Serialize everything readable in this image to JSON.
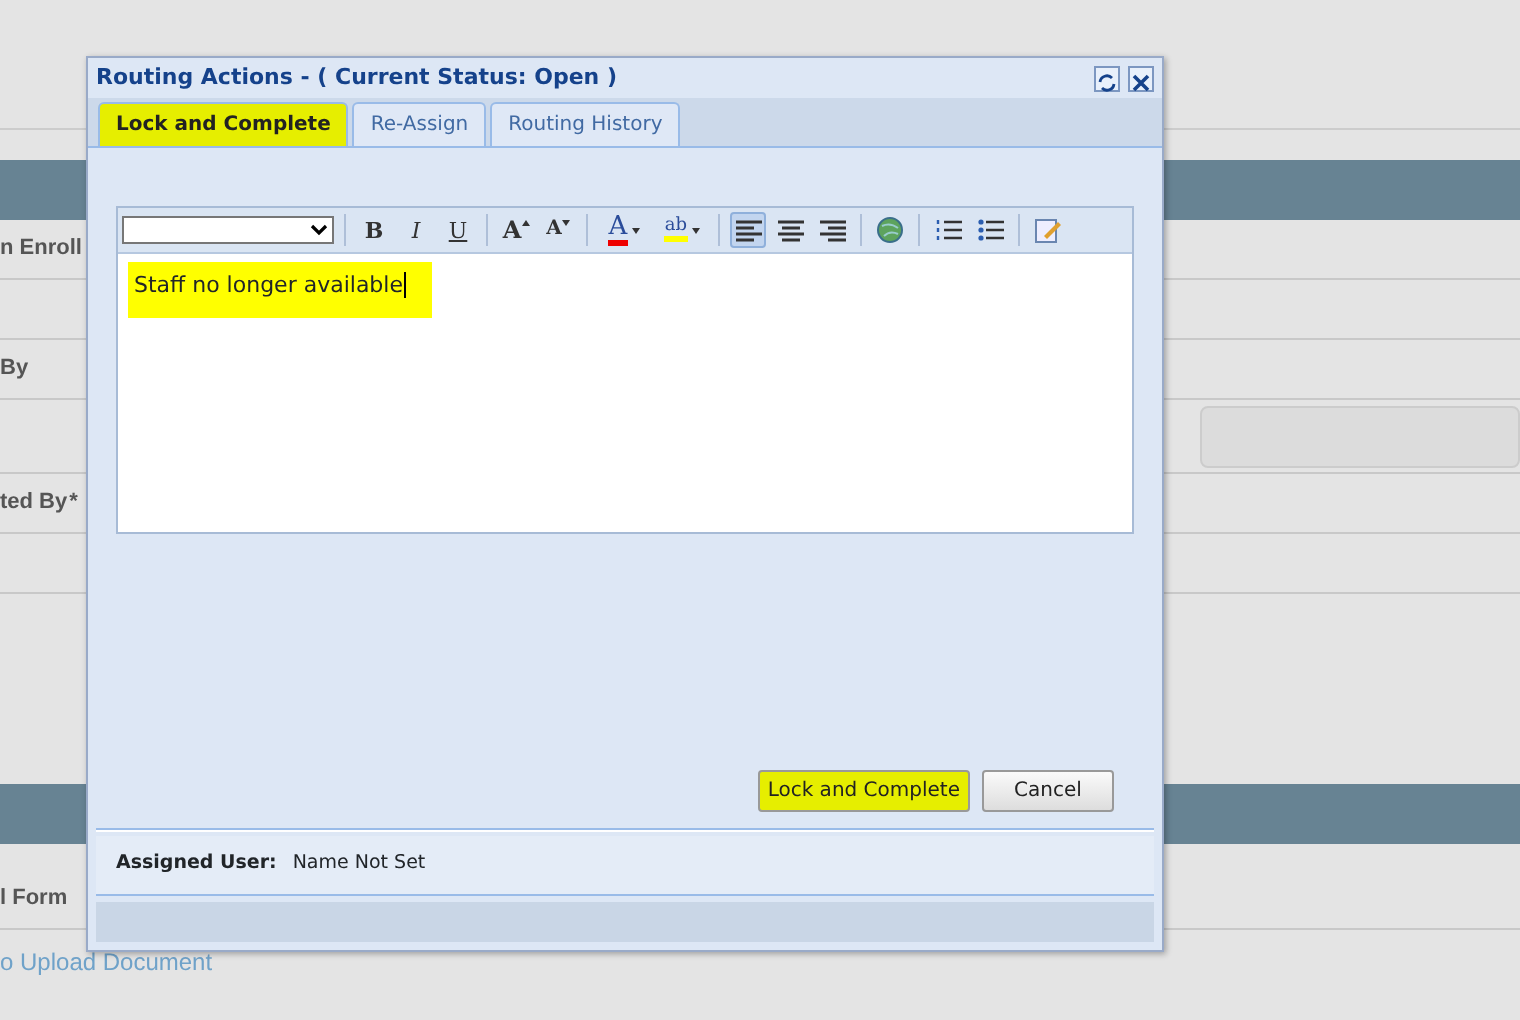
{
  "background": {
    "rows": [
      {
        "kind": "band"
      },
      {
        "kind": "label",
        "text": "n Enroll"
      },
      {
        "kind": "blank"
      },
      {
        "kind": "label",
        "text": "By"
      },
      {
        "kind": "field"
      },
      {
        "kind": "label",
        "text": "ted By",
        "required_mark": "*"
      },
      {
        "kind": "blank"
      },
      {
        "kind": "tall"
      },
      {
        "kind": "band"
      },
      {
        "kind": "label",
        "text": "l Form"
      },
      {
        "kind": "link",
        "text": "o Upload Document"
      }
    ]
  },
  "dialog": {
    "title": "Routing Actions - ( Current Status: Open )",
    "tabs": [
      {
        "label": "Lock and Complete",
        "selected": true,
        "highlight": true
      },
      {
        "label": "Re-Assign",
        "selected": false,
        "highlight": false
      },
      {
        "label": "Routing History",
        "selected": false,
        "highlight": false
      }
    ],
    "toolbar": [
      {
        "kind": "select"
      },
      {
        "kind": "sep"
      },
      {
        "kind": "bold",
        "label": "B",
        "selected": false
      },
      {
        "kind": "italic",
        "label": "I",
        "selected": false
      },
      {
        "kind": "underline",
        "label": "U",
        "selected": false
      },
      {
        "kind": "sep"
      },
      {
        "kind": "grow",
        "label": "A",
        "selected": false
      },
      {
        "kind": "shrink",
        "label": "A",
        "selected": false
      },
      {
        "kind": "sep"
      },
      {
        "kind": "fontcolor",
        "label": "A",
        "selected": false
      },
      {
        "kind": "highlight",
        "label": "ab",
        "selected": false
      },
      {
        "kind": "sep"
      },
      {
        "kind": "alignleft",
        "selected": true
      },
      {
        "kind": "aligncenter",
        "selected": false
      },
      {
        "kind": "alignright",
        "selected": false
      },
      {
        "kind": "sep"
      },
      {
        "kind": "globe",
        "selected": false
      },
      {
        "kind": "sep"
      },
      {
        "kind": "olist",
        "selected": false
      },
      {
        "kind": "ulist",
        "selected": false
      },
      {
        "kind": "sep"
      },
      {
        "kind": "edit",
        "selected": false
      }
    ],
    "editor": {
      "text": "Staff no longer available",
      "highlight": true
    },
    "buttons": [
      {
        "label": "Lock and Complete",
        "highlight": true
      },
      {
        "label": "Cancel",
        "highlight": false
      }
    ],
    "footer": {
      "label": "Assigned User:",
      "value": "Name Not Set"
    }
  }
}
